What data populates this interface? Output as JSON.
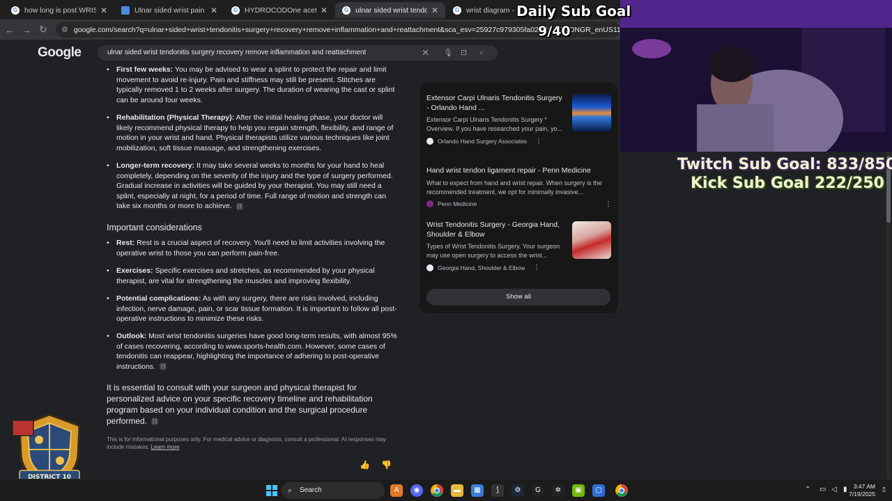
{
  "tabs": [
    {
      "title": "how long is post WRIST tendo",
      "active": false,
      "icon": "google-favicon"
    },
    {
      "title": "Ulnar sided wrist pain - Dorset",
      "active": false,
      "icon": "doc-favicon"
    },
    {
      "title": "HYDROCODOne acetaminophe",
      "active": false,
      "icon": "google-favicon"
    },
    {
      "title": "ulnar sided wrist tendonitis sur",
      "active": true,
      "icon": "google-favicon"
    },
    {
      "title": "wrist diagram - Googl",
      "active": false,
      "icon": "google-favicon"
    }
  ],
  "url": "google.com/search?q=ulnar+sided+wrist+tendonitis+surgery+recovery+remove+inflammation+and+reattachment&sca_esv=25927c979305fa02&rlz=1C1ONGR_enUS1119&sxsrf=AE",
  "google": {
    "logo": "Google",
    "query": "ulnar sided wrist tendonitis surgery recovery remove inflammation and reattachment"
  },
  "recovery_items": [
    {
      "label": "First few weeks:",
      "text": " You may be advised to wear a splint to protect the repair and limit movement to avoid re-injury. Pain and stiffness may still be present. Stitches are typically removed 1 to 2 weeks after surgery. The duration of wearing the cast or splint can be around four weeks."
    },
    {
      "label": "Rehabilitation (Physical Therapy):",
      "text": " After the initial healing phase, your doctor will likely recommend physical therapy to help you regain strength, flexibility, and range of motion in your wrist and hand. Physical therapists utilize various techniques like joint mobilization, soft tissue massage, and strengthening exercises."
    },
    {
      "label": "Longer-term recovery:",
      "text": " It may take several weeks to months for your hand to heal completely, depending on the severity of the injury and the type of surgery performed. Gradual increase in activities will be guided by your therapist. You may still need a splint, especially at night, for a period of time. Full range of motion and strength can take six months or more to achieve."
    }
  ],
  "considerations_heading": "Important considerations",
  "consideration_items": [
    {
      "label": "Rest:",
      "text": " Rest is a crucial aspect of recovery. You'll need to limit activities involving the operative wrist to those you can perform pain-free."
    },
    {
      "label": "Exercises:",
      "text": " Specific exercises and stretches, as recommended by your physical therapist, are vital for strengthening the muscles and improving flexibility."
    },
    {
      "label": "Potential complications:",
      "text": " As with any surgery, there are risks involved, including infection, nerve damage, pain, or scar tissue formation. It is important to follow all post-operative instructions to minimize these risks."
    },
    {
      "label": "Outlook:",
      "text": " Most wrist tendonitis surgeries have good long-term results, with almost 95% of cases recovering, according to www.sports-health.com. However, some cases of tendonitis can reappear, highlighting the importance of adhering to post-operative instructions."
    }
  ],
  "closing_paragraph": "It is essential to consult with your surgeon and physical therapist for personalized advice on your specific recovery timeline and rehabilitation program based on your individual condition and the surgical procedure performed.",
  "disclaimer": "This is for informational purposes only. For medical advice or diagnosis, consult a professional. AI responses may include mistakes.",
  "learn_more": "Learn more",
  "sources": [
    {
      "title": "Extensor Carpi Ulnaris Tendonitis Surgery - Orlando Hand ...",
      "snippet": "Extensor Carpi Ulnaris Tendonitis Surgery * Overview. If you have researched your pain, yo...",
      "site": "Orlando Hand Surgery Associates"
    },
    {
      "title": "Hand wrist tendon ligament repair - Penn Medicine",
      "snippet": "What to expect from hand and wrist repair. When surgery is the recommended treatment, we opt for minimally invasive...",
      "site": "Penn Medicine"
    },
    {
      "title": "Wrist Tendonitis Surgery - Georgia Hand, Shoulder & Elbow",
      "snippet": "Types of Wrist Tendonitis Surgery. Your surgeon may use open surgery to access the wrist...",
      "site": "Georgia Hand, Shoulder & Elbow"
    }
  ],
  "show_all": "Show all",
  "stream": {
    "daily_goal": "Daily Sub Goal",
    "daily_count": "9/40",
    "twitch_goal": "Twitch Sub Goal: 833/850",
    "kick_goal": "Kick Sub Goal 222/250",
    "badge_text": "DISTRICT 10"
  },
  "taskbar": {
    "search": "Search",
    "time": "3:47 AM",
    "date": "7/19/2025"
  },
  "colors": {
    "accent": "#8ab4f8",
    "bg": "#202124",
    "overlay_goal": "#f5f2d0"
  }
}
